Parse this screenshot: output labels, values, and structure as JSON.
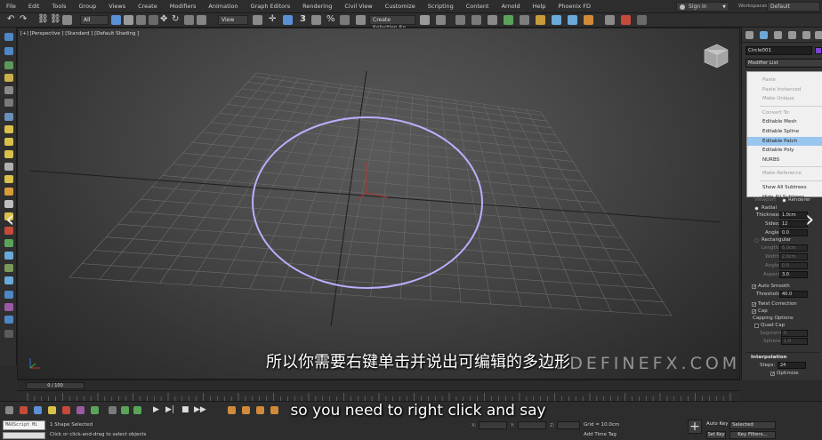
{
  "menubar": {
    "items": [
      "File",
      "Edit",
      "Tools",
      "Group",
      "Views",
      "Create",
      "Modifiers",
      "Animation",
      "Graph Editors",
      "Rendering",
      "Civil View",
      "Customize",
      "Scripting",
      "Content",
      "Arnold",
      "Help",
      "Phoenix FD"
    ],
    "signin": "Sign In",
    "workspace_label": "Workspaces:",
    "workspace_value": "Default"
  },
  "toolbar": {
    "filter_dropdown": "All",
    "view_dropdown": "View",
    "snap_label": "3",
    "selection_set": "Create Selection Se"
  },
  "viewport": {
    "label": "[+] [Perspective ] [Standard ] [Default Shading ]",
    "circle_color": "#b9b0ff",
    "watermark": "REDEFINEFX.COM"
  },
  "subtitles": {
    "chinese": "所以你需要右键单击并说出可编辑的多边形",
    "english": "so you need to right click and say"
  },
  "command_panel": {
    "object_name": "Circle001",
    "object_color": "#7a45d6",
    "modifier_list": "Modifier List",
    "context_menu": [
      {
        "label": "Paste",
        "state": "disabled"
      },
      {
        "label": "Paste Instanced",
        "state": "disabled"
      },
      {
        "label": "Make Unique",
        "state": "disabled"
      },
      {
        "label": "Convert To:",
        "state": "disabled"
      },
      {
        "label": "Editable Mesh",
        "state": "normal"
      },
      {
        "label": "Editable Spline",
        "state": "normal"
      },
      {
        "label": "Editable Patch",
        "state": "highlighted"
      },
      {
        "label": "Editable Poly",
        "state": "normal"
      },
      {
        "label": "NURBS",
        "state": "normal"
      },
      {
        "label": "Make Reference",
        "state": "disabled"
      },
      {
        "label": "Show All Subtrees",
        "state": "normal"
      },
      {
        "label": "Hide All Subtrees",
        "state": "normal"
      }
    ],
    "viewport_label": "Viewport",
    "renderer_label": "Renderer",
    "radial_label": "Radial",
    "thickness_label": "Thickness:",
    "thickness_value": "1.0cm",
    "sides_label": "Sides:",
    "sides_value": "12",
    "angle_label": "Angle:",
    "angle_value": "0.0",
    "rectangular_label": "Rectangular",
    "length_label": "Length:",
    "length_value": "6.0cm",
    "width_label": "Width:",
    "width_value": "2.0cm",
    "rect_angle_label": "Angle:",
    "rect_angle_value": "0.0",
    "aspect_label": "Aspect:",
    "aspect_value": "3.0",
    "auto_smooth_label": "Auto Smooth",
    "threshold_label": "Threshold:",
    "threshold_value": "40.0",
    "twist_label": "Twist Correction",
    "cap_label": "Cap",
    "capping_options_label": "Capping Options",
    "quad_cap_label": "Quad Cap",
    "segments_label": "Segments:",
    "segments_value": "0",
    "sphere_label": "Sphere:",
    "sphere_value": "1.0",
    "interpolation_header": "Interpolation",
    "steps_label": "Steps:",
    "steps_value": "24",
    "optimize_label": "Optimize"
  },
  "timeline": {
    "counter": "0 / 100"
  },
  "statusbar": {
    "maxscript_label": "MAXScript Mi",
    "selection_status": "1 Shape Selected",
    "prompt": "Click or click-and-drag to select objects",
    "x_label": "X:",
    "y_label": "Y:",
    "z_label": "Z:",
    "grid": "Grid = 10.0cm",
    "add_time_tag": "Add Time Tag",
    "auto_key": "Auto Key",
    "set_key": "Set Key",
    "selected_dropdown": "Selected",
    "key_filters": "Key Filters..."
  }
}
